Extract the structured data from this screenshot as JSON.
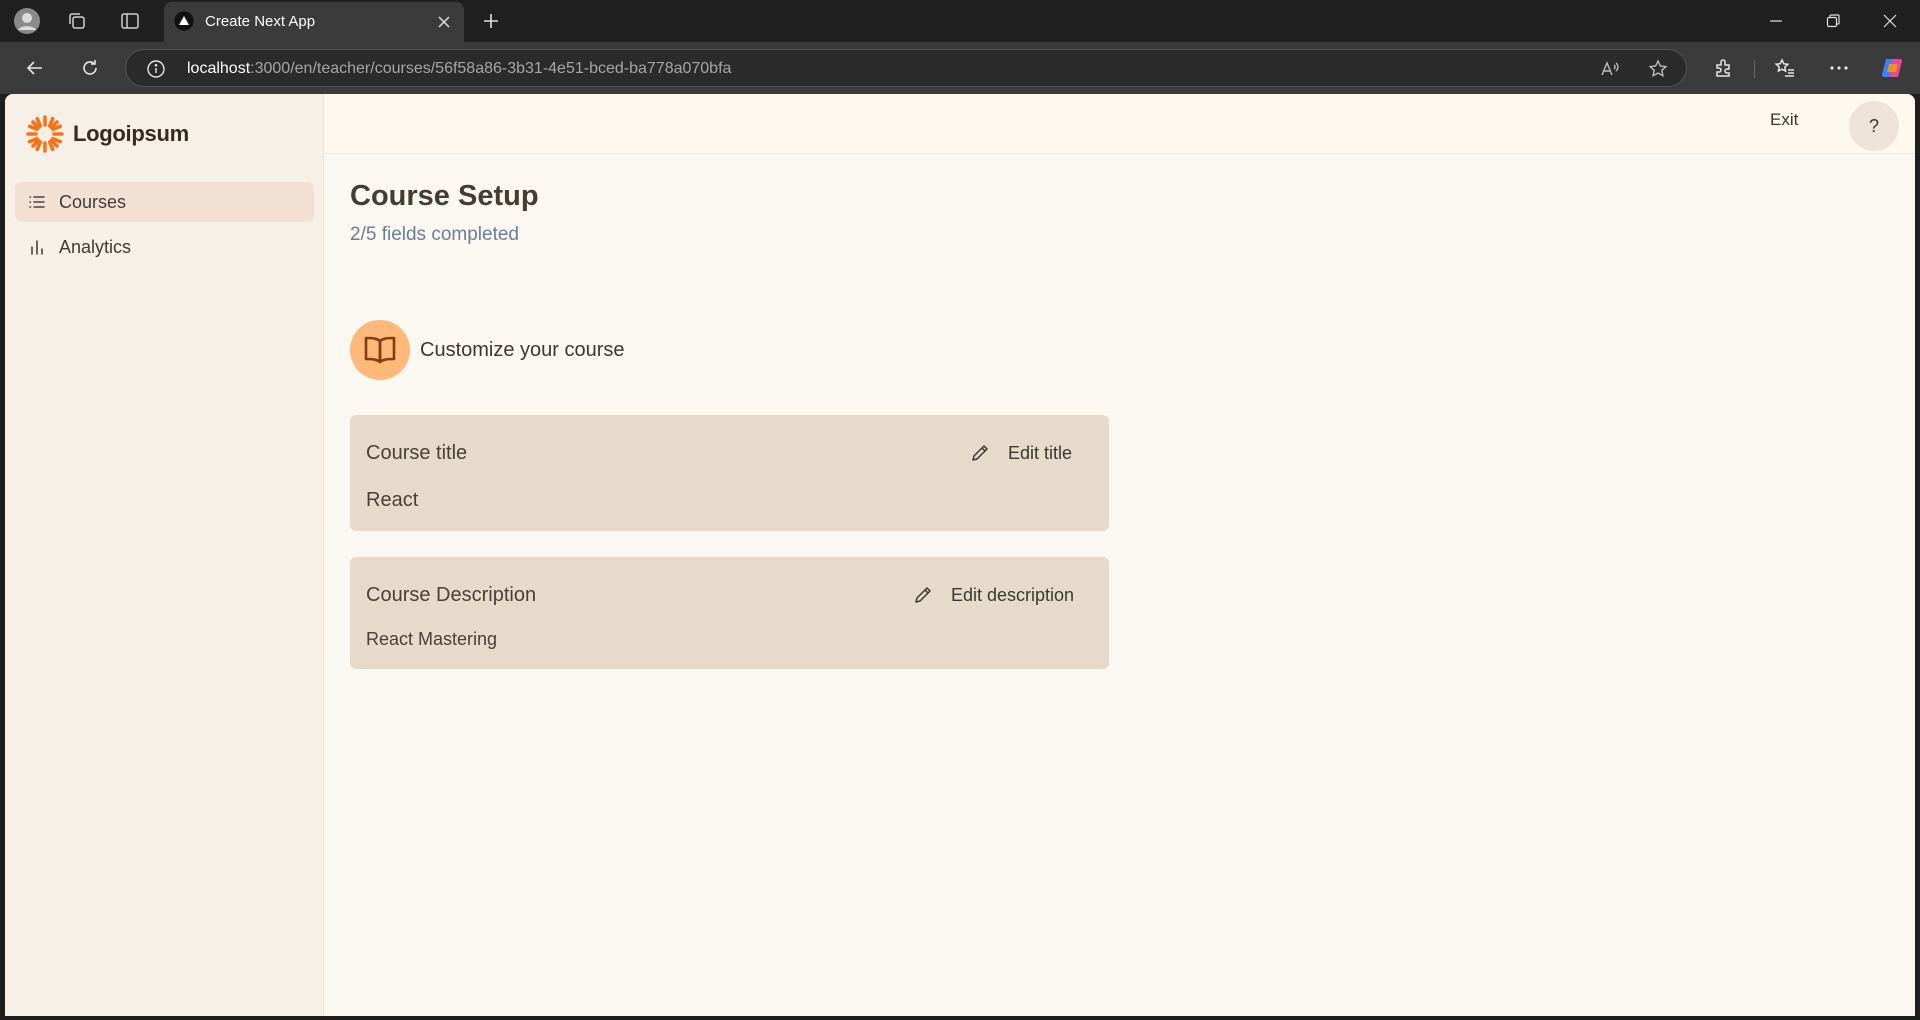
{
  "browser": {
    "tab_title": "Create Next App",
    "url_host": "localhost",
    "url_rest": ":3000/en/teacher/courses/56f58a86-3b31-4e51-bced-ba778a070bfa"
  },
  "sidebar": {
    "logo_text": "Logoipsum",
    "items": [
      {
        "label": "Courses",
        "icon": "list-icon",
        "active": true
      },
      {
        "label": "Analytics",
        "icon": "bar-chart-icon",
        "active": false
      }
    ]
  },
  "topbar": {
    "exit_label": "Exit",
    "help_label": "?"
  },
  "main": {
    "title": "Course Setup",
    "progress": "2/5 fields completed",
    "section_title": "Customize your course",
    "cards": [
      {
        "label": "Course title",
        "edit_label": "Edit title",
        "value": "React"
      },
      {
        "label": "Course Description",
        "edit_label": "Edit description",
        "value": "React Mastering"
      }
    ]
  },
  "colors": {
    "accent_orange": "#f97316",
    "section_icon_bg": "#fcb97a",
    "card_bg": "#e6dacb",
    "progress_text": "#6b7f99"
  }
}
